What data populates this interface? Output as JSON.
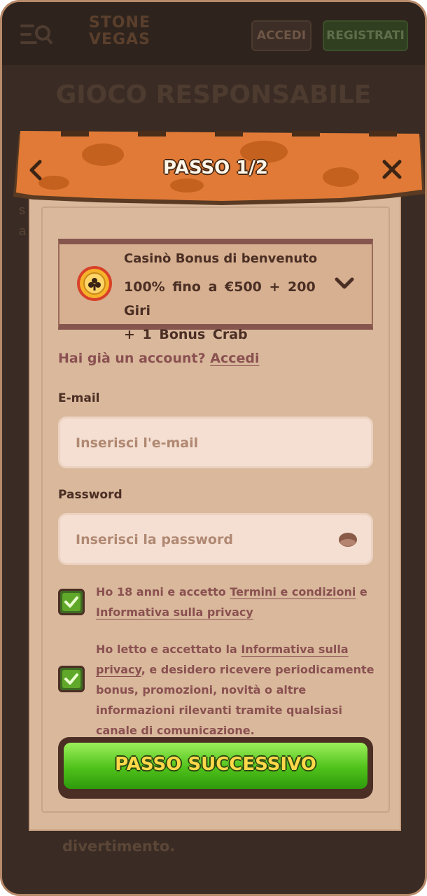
{
  "header": {
    "logo_text_1": "STONE",
    "logo_text_2": "VEGAS",
    "login_label": "ACCEDI",
    "register_label": "REGISTRATI"
  },
  "background": {
    "page_title": "GIOCO RESPONSABILE",
    "side_text_1": "s",
    "side_text_2": "a",
    "bottom_text": "divertimento."
  },
  "modal": {
    "title": "PASSO 1/2",
    "bonus": {
      "title": "Casinò Bonus di benvenuto",
      "line1": "100% fino a €500 + 200 Giri",
      "line2": "+ 1 Bonus Crab"
    },
    "have_account": "Hai già un account?",
    "login_link": "Accedi",
    "email": {
      "label": "E-mail",
      "placeholder": "Inserisci l'e-mail",
      "value": ""
    },
    "password": {
      "label": "Password",
      "placeholder": "Inserisci la password",
      "value": ""
    },
    "consent1": {
      "checked": true,
      "text_a": "Ho 18 anni e accetto ",
      "link_terms": "Termini e condizioni",
      "text_b": " e",
      "link_privacy": "Informativa sulla privacy"
    },
    "consent2": {
      "checked": true,
      "text_a": "Ho letto e accettato la ",
      "link_privacy": "Informativa sulla privacy",
      "text_b": ", e desidero ricevere periodicamente bonus, promozioni, novità o altre informazioni rilevanti tramite qualsiasi canale di comunicazione."
    },
    "next_label": "PASSO SUCCESSIVO"
  },
  "colors": {
    "accent_green": "#4fc11a",
    "link": "#8a5050",
    "banner_orange": "#e07a36"
  },
  "icons": {
    "menu": "menu-search-icon",
    "back": "chevron-left-icon",
    "close": "close-icon",
    "chip": "casino-chip-icon",
    "expand": "chevron-down-icon",
    "eye": "eye-icon",
    "check": "check-icon"
  }
}
